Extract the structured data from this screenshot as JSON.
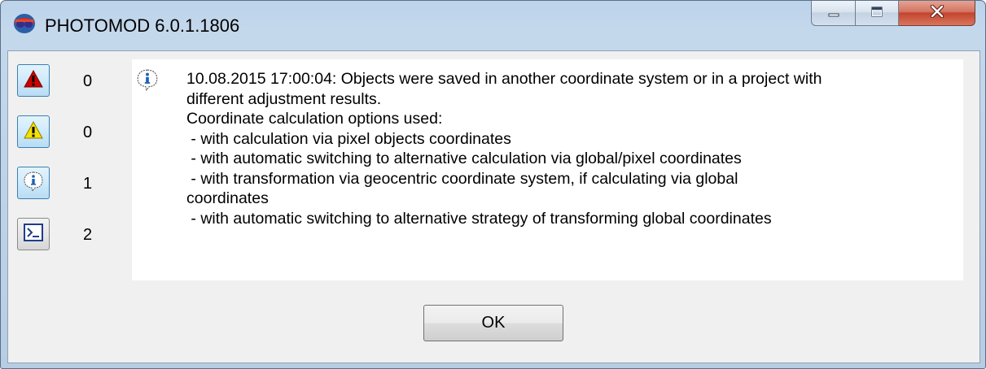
{
  "window": {
    "title": "PHOTOMOD 6.0.1.1806"
  },
  "caption_buttons": {
    "minimize_icon": "minimize-icon",
    "maximize_icon": "maximize-icon",
    "close_icon": "close-icon"
  },
  "filters": [
    {
      "icon": "error-triangle-icon",
      "count": "0"
    },
    {
      "icon": "warning-triangle-icon",
      "count": "0"
    },
    {
      "icon": "info-icon",
      "count": "1"
    },
    {
      "icon": "console-icon",
      "count": "2"
    }
  ],
  "message": {
    "icon": "info-icon",
    "lines": [
      "10.08.2015 17:00:04: Objects were saved in another coordinate system or in a project with",
      "different adjustment results.",
      "Coordinate calculation options used:",
      " - with calculation via pixel objects coordinates",
      " - with automatic switching to alternative calculation via global/pixel coordinates",
      " - with transformation via geocentric coordinate system, if calculating via global",
      "coordinates",
      " - with automatic switching to alternative strategy of transforming global coordinates"
    ]
  },
  "ok_label": "OK",
  "colors": {
    "error": "#cc0000",
    "warning": "#f5e100",
    "info": "#1e5fb4",
    "close": "#c4442d"
  }
}
